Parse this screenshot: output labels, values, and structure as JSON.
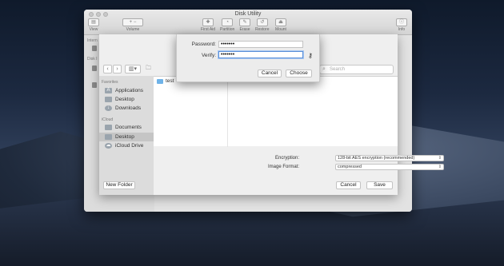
{
  "window": {
    "title": "Disk Utility"
  },
  "toolbar": {
    "view": "View",
    "volume": "Volume",
    "first_aid": "First Aid",
    "partition": "Partition",
    "erase": "Erase",
    "restore": "Restore",
    "mount": "Mount",
    "info": "Info"
  },
  "sidebar": {
    "internal": "Intern",
    "disk": "Disk I"
  },
  "sheet": {
    "password_label": "Password:",
    "password_value": "•••••••",
    "verify_label": "Verify:",
    "verify_value": "•••••••",
    "cancel": "Cancel",
    "choose": "Choose"
  },
  "panel": {
    "search_placeholder": "Search",
    "favorites_header": "Favorites",
    "icloud_header": "iCloud",
    "favorites": [
      {
        "label": "Applications",
        "icon": "applications-icon"
      },
      {
        "label": "Desktop",
        "icon": "desktop-icon"
      },
      {
        "label": "Downloads",
        "icon": "downloads-icon"
      }
    ],
    "icloud": [
      {
        "label": "Documents",
        "icon": "documents-icon"
      },
      {
        "label": "Desktop",
        "icon": "desktop-icon",
        "selected": true
      },
      {
        "label": "iCloud Drive",
        "icon": "icloud-drive-icon"
      }
    ],
    "files": [
      {
        "name": "test",
        "icon": "folder-icon"
      }
    ],
    "encryption_label": "Encryption:",
    "encryption_value": "128-bit AES encryption (recommended)",
    "format_label": "Image Format:",
    "format_value": "compressed",
    "new_folder": "New Folder",
    "cancel": "Cancel",
    "save": "Save"
  },
  "colors": {
    "accent": "#5a8fd8",
    "folder": "#6fb3e8"
  }
}
